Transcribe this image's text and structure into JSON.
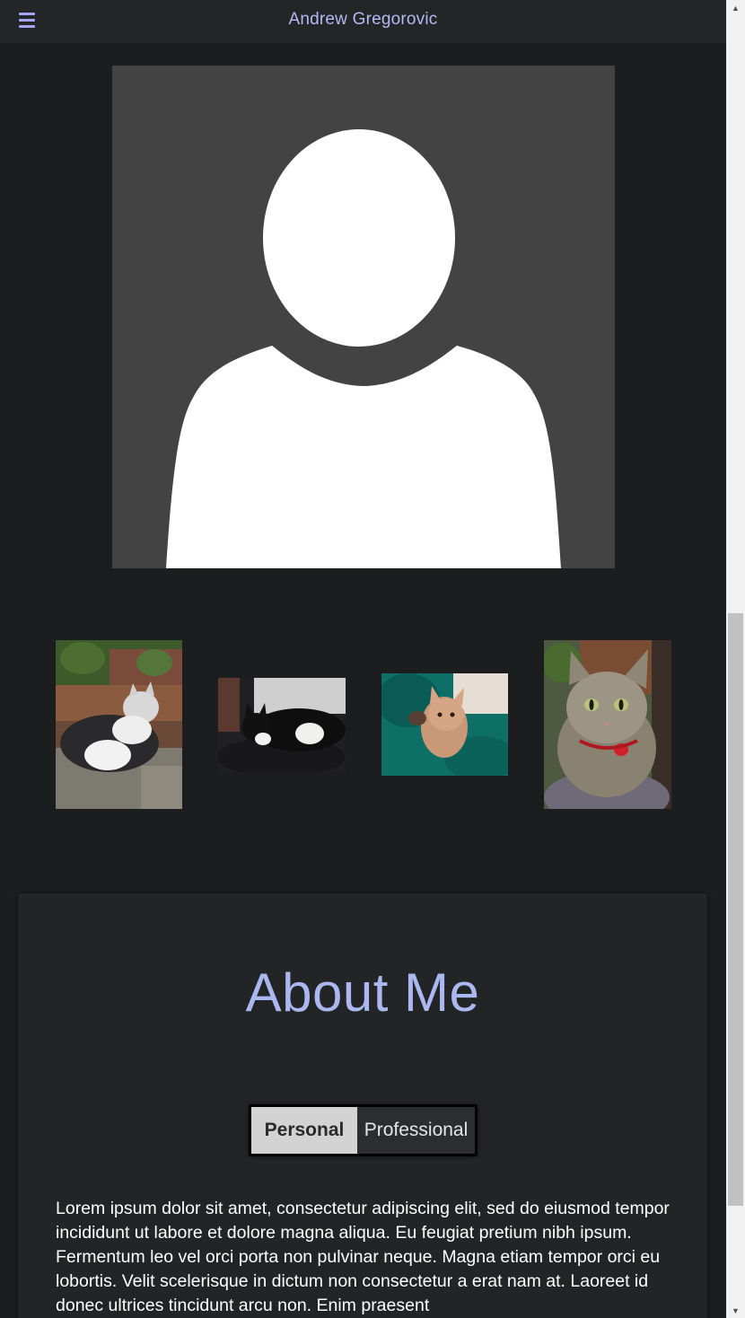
{
  "header": {
    "menu_icon": "hamburger-menu-icon",
    "title": "Andrew Gregorovic"
  },
  "profile": {
    "avatar_icon": "default-user-silhouette-icon"
  },
  "gallery": {
    "photos": [
      {
        "name": "cat-photo-1",
        "description": "white and black cat lying on a log"
      },
      {
        "name": "cat-photo-2",
        "description": "black and white cat lying on a dark cushion"
      },
      {
        "name": "cat-photo-3",
        "description": "orange cat lying on a teal blanket"
      },
      {
        "name": "cat-photo-4",
        "description": "tabby cat with red collar"
      }
    ]
  },
  "about": {
    "title": "About Me",
    "tabs": {
      "personal": "Personal",
      "professional": "Professional",
      "active": "Personal"
    },
    "text": "Lorem ipsum dolor sit amet, consectetur adipiscing elit, sed do eiusmod tempor incididunt ut labore et dolore magna aliqua. Eu feugiat pretium nibh ipsum. Fermentum leo vel orci porta non pulvinar neque. Magna etiam tempor orci eu lobortis. Velit scelerisque in dictum non consectetur a erat nam at. Laoreet id donec ultrices tincidunt arcu non. Enim praesent"
  },
  "colors": {
    "background": "#1b1d1f",
    "header": "#232527",
    "accent": "#aab8ef",
    "card": "#222426"
  }
}
